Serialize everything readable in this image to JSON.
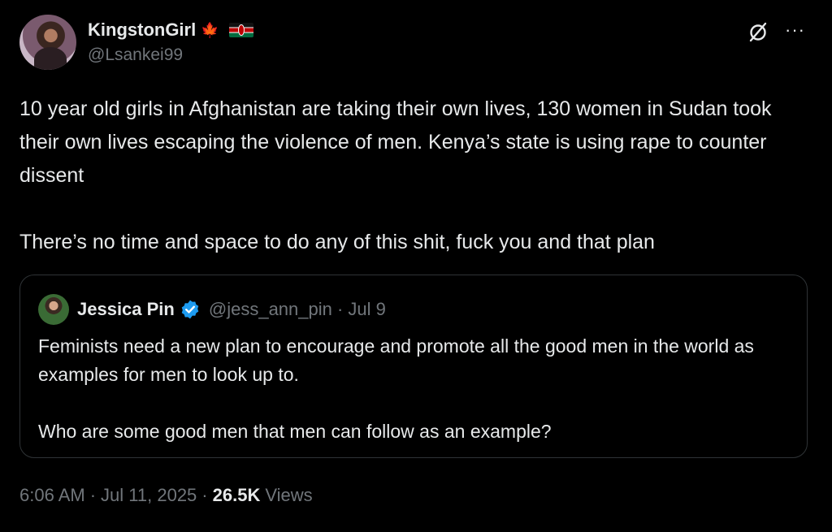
{
  "author": {
    "display_name": "KingstonGirl",
    "flag_canada": "🍁",
    "handle": "@Lsankei99"
  },
  "header_icons": [
    "grok-icon",
    "more-icon"
  ],
  "more_glyph": "···",
  "tweet": {
    "paragraphs": [
      "10 year old girls in Afghanistan are taking their own lives, 130 women in Sudan took their own lives escaping the violence of men. Kenya’s state is using rape to counter dissent",
      "There’s no time and space to do any of this shit, fuck you and that plan"
    ]
  },
  "quote": {
    "display_name": "Jessica Pin",
    "handle_date": "@jess_ann_pin · Jul 9",
    "paragraphs": [
      "Feminists need a new plan to encourage and promote all the good men in the world as examples for men to look up to.",
      "Who are some good men that men can follow as an example?"
    ]
  },
  "footer": {
    "time": "6:06 AM",
    "date": "Jul 11, 2025",
    "views_count": "26.5K",
    "views_label": "Views",
    "separator": "·"
  },
  "colors": {
    "background": "#000000",
    "text_primary": "#e7e9ea",
    "text_secondary": "#71767b",
    "border": "#2f3336",
    "verified_blue": "#1d9bf0"
  }
}
